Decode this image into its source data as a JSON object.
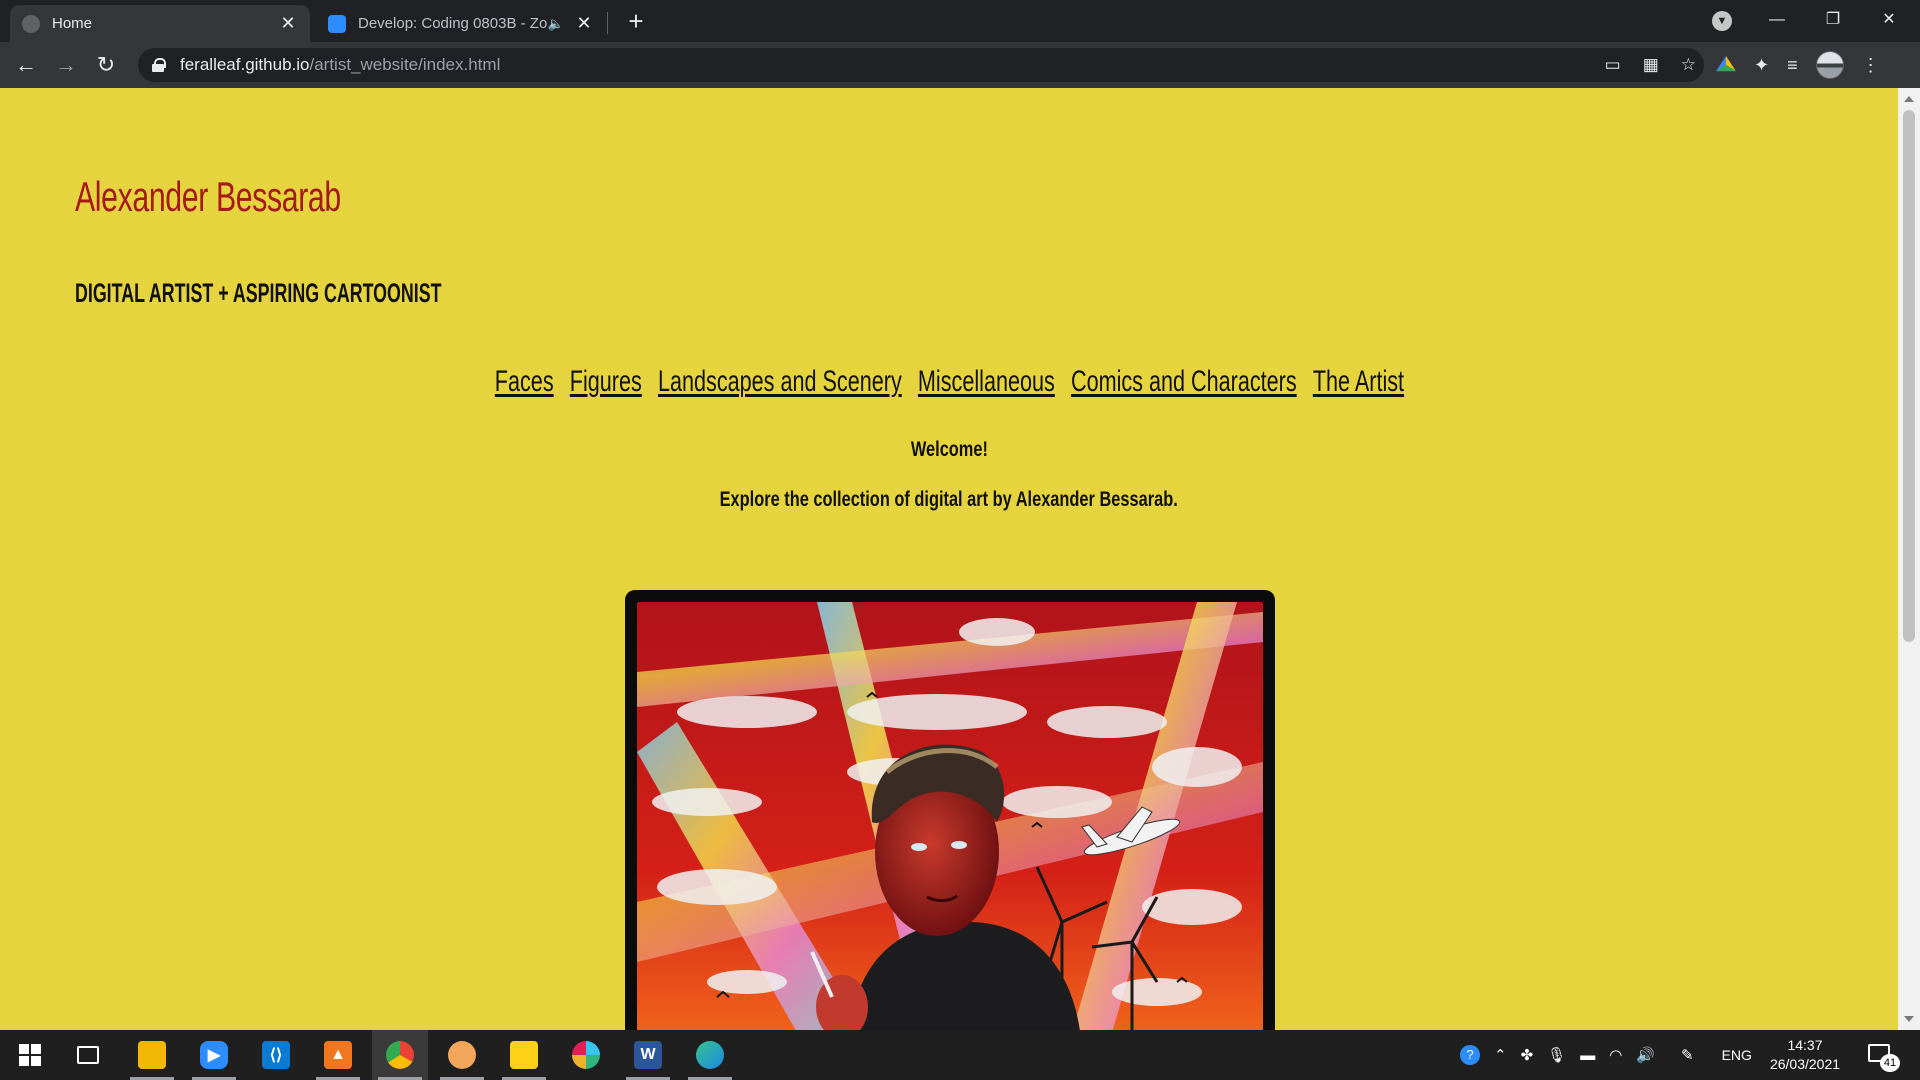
{
  "browser": {
    "tabs": [
      {
        "title": "Home",
        "active": true
      },
      {
        "title": "Develop: Coding 0803B - Zo",
        "active": false
      }
    ],
    "url_host": "feralleaf.github.io",
    "url_path": "/artist_website/index.html",
    "icons": {
      "back": "arrow-left-icon",
      "forward": "arrow-right-icon",
      "reload": "reload-icon",
      "lock": "lock-icon",
      "cast": "cast-icon",
      "translate": "translate-icon",
      "bookmark": "star-icon",
      "extensions": "puzzle-icon",
      "reading_list": "reading-list-icon",
      "menu": "kebab-menu-icon"
    }
  },
  "page": {
    "site_title": "Alexander Bessarab",
    "tagline": "Digital Artist + Aspiring Cartoonist",
    "nav": [
      {
        "label": "Faces"
      },
      {
        "label": "Figures"
      },
      {
        "label": "Landscapes and Scenery"
      },
      {
        "label": "Miscellaneous"
      },
      {
        "label": "Comics and Characters"
      },
      {
        "label": "The Artist"
      }
    ],
    "welcome": "Welcome!",
    "intro": "Explore the collection of digital art by Alexander Bessarab.",
    "colors": {
      "background": "#e6d43e",
      "title": "#a61919",
      "text": "#111111",
      "frame": "#0b0b0b"
    }
  },
  "taskbar": {
    "apps": [
      "start-icon",
      "task-view-icon",
      "file-explorer-icon",
      "zoom-icon",
      "vscode-icon",
      "app-icon",
      "chrome-icon",
      "app-icon-orange",
      "sticky-notes-icon",
      "slack-icon",
      "word-icon",
      "edge-icon"
    ],
    "language": "ENG",
    "time": "14:37",
    "date": "26/03/2021",
    "notifications": "41"
  }
}
